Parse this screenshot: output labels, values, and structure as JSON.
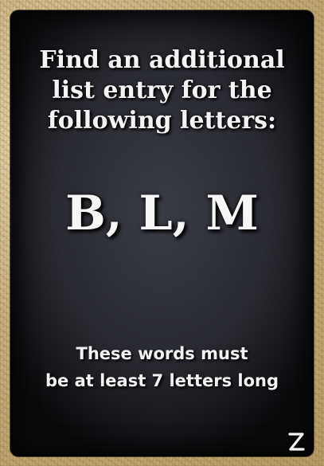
{
  "card": {
    "heading": "Find an additional list entry for the following letters:",
    "letters": "B, L, M",
    "note_line1": "These words must",
    "note_line2": "be at least 7 letters long",
    "logo_icon": "z-logo-icon"
  },
  "colors": {
    "card_center": "#3a3c45",
    "card_edge": "#0a0a0c",
    "text": "#f4f4f4",
    "frame": "#c9b27c"
  }
}
